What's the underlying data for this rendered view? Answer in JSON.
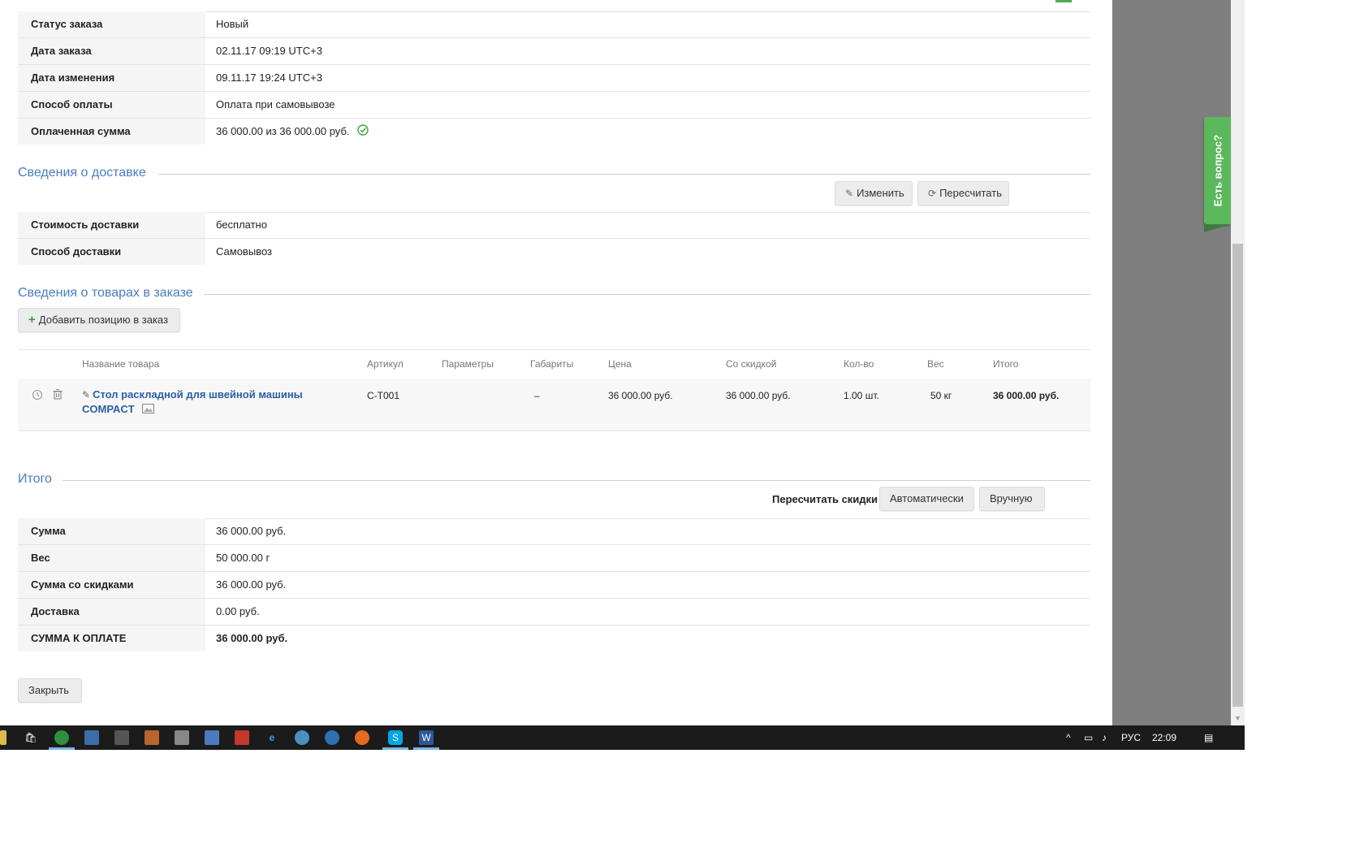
{
  "order_info": [
    {
      "label": "Статус заказа",
      "value": "Новый"
    },
    {
      "label": "Дата заказа",
      "value": "02.11.17 09:19 UTC+3"
    },
    {
      "label": "Дата изменения",
      "value": "09.11.17 19:24 UTC+3"
    },
    {
      "label": "Способ оплаты",
      "value": "Оплата при самовывозе"
    },
    {
      "label": "Оплаченная сумма",
      "value": "36 000.00 из 36 000.00 руб."
    }
  ],
  "delivery": {
    "title": "Сведения о доставке",
    "edit_label": "Изменить",
    "recalc_label": "Пересчитать",
    "rows": [
      {
        "label": "Стоимость доставки",
        "value": "бесплатно"
      },
      {
        "label": "Способ доставки",
        "value": "Самовывоз"
      }
    ]
  },
  "products": {
    "title": "Сведения о товарах в заказе",
    "add_label": "Добавить позицию в заказ",
    "columns": [
      "Название товара",
      "Артикул",
      "Параметры",
      "Габариты",
      "Цена",
      "Со скидкой",
      "Кол-во",
      "Вес",
      "Итого"
    ],
    "items": [
      {
        "name_line1": "Стол раскладной для швейной машины",
        "name_line2": "COMPACT",
        "sku": "C-T001",
        "params": "",
        "dims": "–",
        "price": "36 000.00 руб.",
        "discounted": "36 000.00 руб.",
        "qty": "1.00 шт.",
        "weight": "50 кг",
        "total": "36 000.00 руб."
      }
    ]
  },
  "totals": {
    "title": "Итого",
    "recalc_discount_label": "Пересчитать скидки",
    "auto_label": "Автоматически",
    "manual_label": "Вручную",
    "rows": [
      {
        "label": "Сумма",
        "value": "36 000.00 руб."
      },
      {
        "label": "Вес",
        "value": "50 000.00 г"
      },
      {
        "label": "Сумма со скидками",
        "value": "36 000.00 руб."
      },
      {
        "label": "Доставка",
        "value": "0.00 руб."
      },
      {
        "label": "СУММА К ОПЛАТЕ",
        "value": "36 000.00 руб."
      }
    ]
  },
  "close_label": "Закрыть",
  "feedback_label": "Есть вопрос?",
  "taskbar": {
    "lang": "РУС",
    "time": "22:09"
  },
  "colors": {
    "accent": "#4a7bbf",
    "link": "#2a5ea8",
    "feedback": "#5cb85c"
  }
}
